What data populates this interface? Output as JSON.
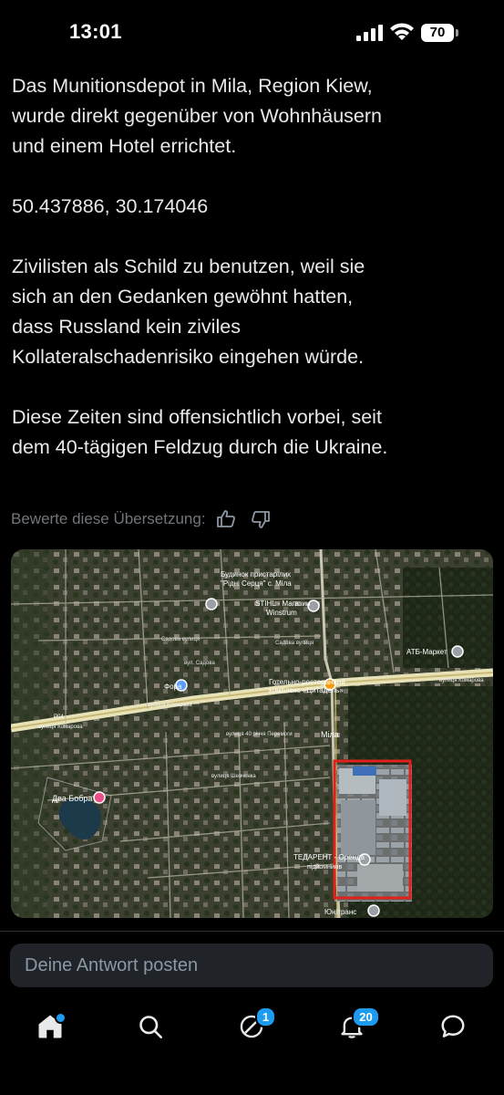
{
  "status_bar": {
    "time": "13:01",
    "battery": "70"
  },
  "post": {
    "paragraphs": [
      [
        "Das Munitionsdepot in Mila, Region Kiew,",
        "wurde direkt gegenüber von Wohnhäusern",
        "und einem Hotel errichtet."
      ],
      [
        "50.437886, 30.174046"
      ],
      [
        "Zivilisten als Schild zu benutzen, weil sie",
        "sich an den Gedanken gewöhnt hatten,",
        "dass Russland kein ziviles",
        "Kollateralschadenrisiko eingehen würde."
      ],
      [
        "Diese Zeiten sind offensichtlich vorbei, seit",
        "dem 40-tägigen Feldzug durch die Ukraine."
      ]
    ],
    "rate_translation": "Bewerte diese Übersetzung:"
  },
  "map": {
    "labels": {
      "retirement_home": "Будинок пристарілих\n\"Рідні Серця\" с. Міла",
      "sthl": "STIHL - Магазин\nWinstrum",
      "atb": "АТБ-Маркет",
      "sadova_1": "Садова вулиця",
      "sadova_2": "Садова вулиця",
      "fora": "Фора",
      "hotel": "Готельно-ресторанний\nкомплекс «Цитадель»",
      "komarova_top": "вулиця Комарова",
      "komarova_left": "вулиця Комарова",
      "komarova_left2": "вулиця Комарова",
      "street_40": "вулиця 40 річчя Перемоги",
      "mila": "Міла",
      "shevchenka": "вулиця Шевченка",
      "dva_bobra": "Два Бобра",
      "tedarent": "ТЕДАРЕНТ - Оренда\nпідйомників",
      "unitrans": "Юнітранс",
      "road_num": "Р04"
    },
    "highlight_color": "#e0201a"
  },
  "reply": {
    "placeholder": "Deine Antwort posten"
  },
  "tabbar": {
    "items": [
      "home-icon",
      "search-icon",
      "spaces-icon",
      "notifications-icon",
      "messages-icon"
    ],
    "spaces_badge": "1",
    "notifications_badge": "20"
  },
  "colors": {
    "accent": "#1d9bf0",
    "background": "#000000",
    "text": "#e7e9ea",
    "muted": "#71767b"
  }
}
